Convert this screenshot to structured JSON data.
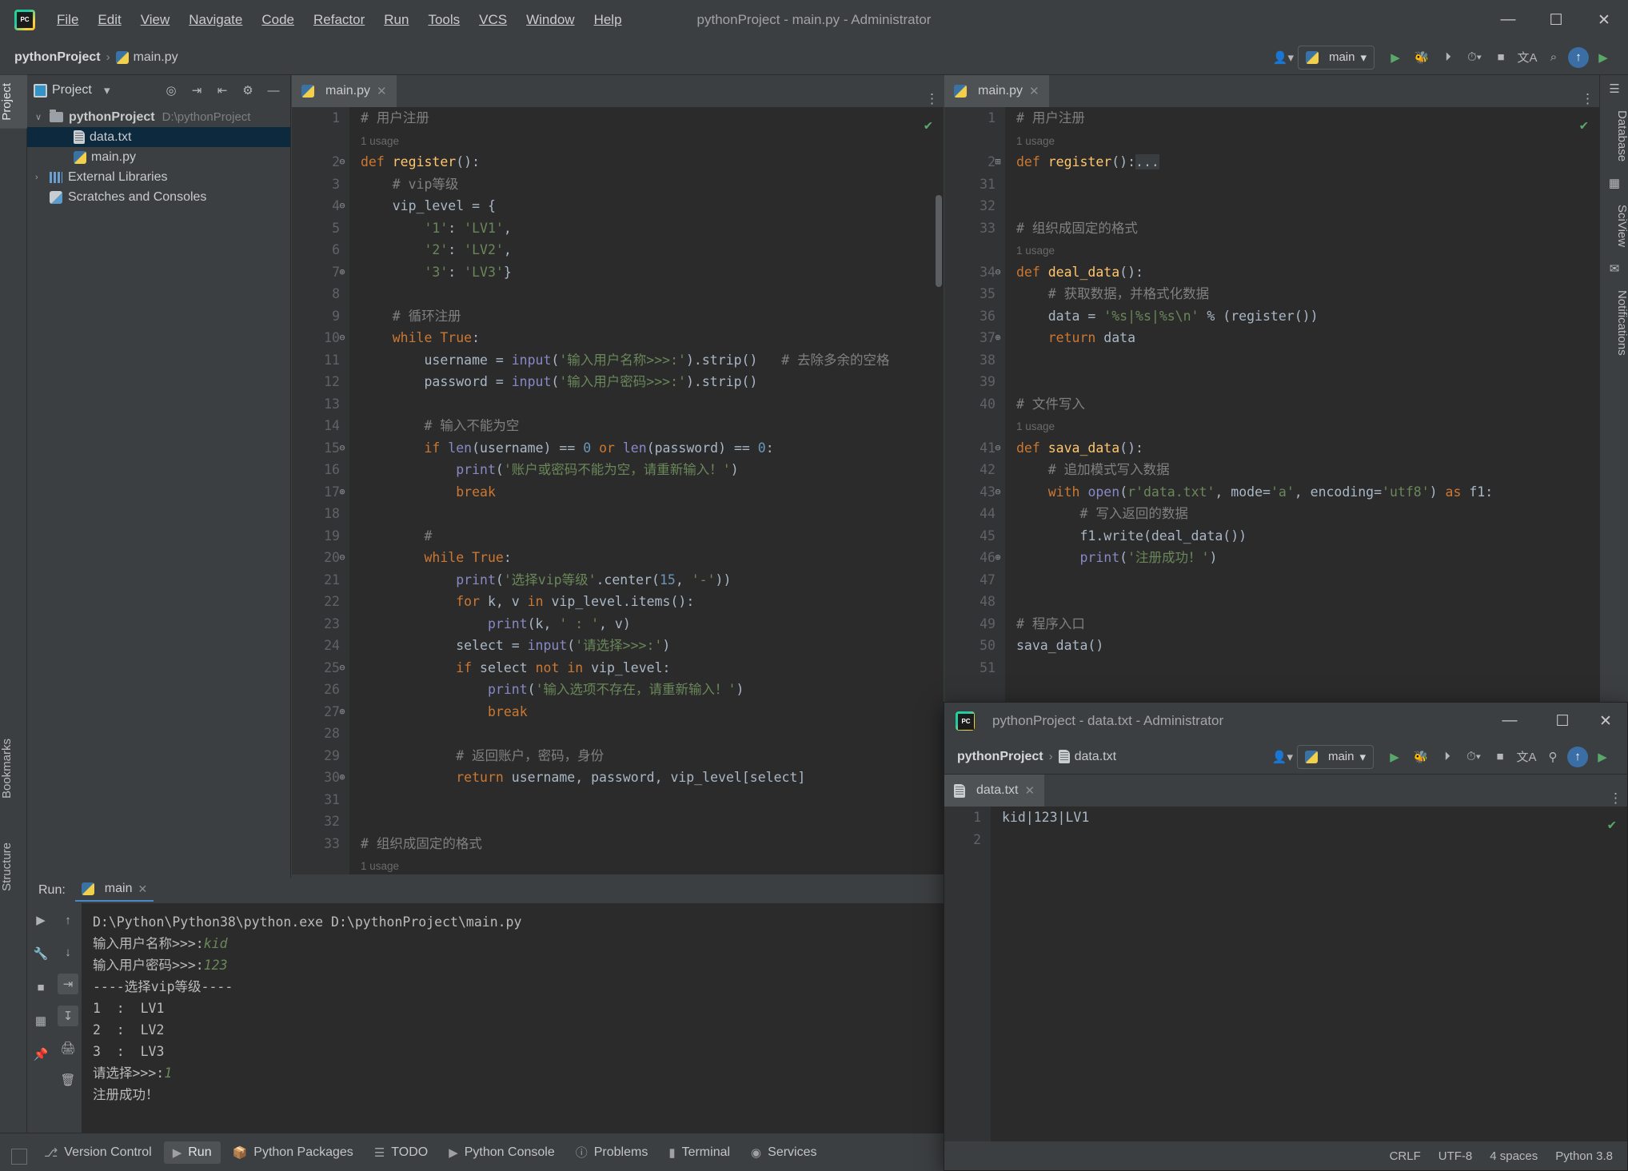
{
  "window": {
    "title": "pythonProject - main.py - Administrator",
    "controls": {
      "minimize": "—",
      "maximize": "☐",
      "close": "✕"
    }
  },
  "menubar": [
    {
      "label": "File"
    },
    {
      "label": "Edit"
    },
    {
      "label": "View"
    },
    {
      "label": "Navigate"
    },
    {
      "label": "Code"
    },
    {
      "label": "Refactor"
    },
    {
      "label": "Run"
    },
    {
      "label": "Tools"
    },
    {
      "label": "VCS"
    },
    {
      "label": "Window"
    },
    {
      "label": "Help"
    }
  ],
  "breadcrumb": {
    "project": "pythonProject",
    "separator": "›",
    "file": "main.py"
  },
  "toolbar": {
    "run_config": "main",
    "profile_icon": "user-icon",
    "run": "▶",
    "debug": "bug-icon",
    "coverage": "coverage-icon",
    "profile": "profiler-icon",
    "stop": "■",
    "translate": "translate-icon",
    "search": "⌕",
    "updates": "↑",
    "ide_run": "▶"
  },
  "sidebar": {
    "vertical_tabs": [
      "Project",
      "Bookmarks",
      "Structure"
    ],
    "panel_title": "Project",
    "header_icons": [
      "locate-icon",
      "expand-all-icon",
      "collapse-all-icon",
      "settings-icon",
      "hide-icon"
    ],
    "tree": [
      {
        "label": "pythonProject",
        "path": "D:\\pythonProject",
        "icon": "folder-icon",
        "arrow": "∨",
        "bold": true,
        "selected": false,
        "indent": 0
      },
      {
        "label": "data.txt",
        "path": "",
        "icon": "text-file-icon",
        "arrow": "",
        "bold": false,
        "selected": true,
        "indent": 1
      },
      {
        "label": "main.py",
        "path": "",
        "icon": "python-file-icon",
        "arrow": "",
        "bold": false,
        "selected": false,
        "indent": 1
      },
      {
        "label": "External Libraries",
        "path": "",
        "icon": "library-icon",
        "arrow": "›",
        "bold": false,
        "selected": false,
        "indent": 0
      },
      {
        "label": "Scratches and Consoles",
        "path": "",
        "icon": "scratch-icon",
        "arrow": "",
        "bold": false,
        "selected": false,
        "indent": 0
      }
    ]
  },
  "editors": {
    "left": {
      "tab_label": "main.py",
      "tab_close": "✕",
      "inspection_status": "✔",
      "lines": [
        {
          "no": "1",
          "fold": "",
          "html": "<span class='cmt'># 用户注册</span>"
        },
        {
          "no": "",
          "fold": "",
          "html": "<span class='usage'>1 usage</span>"
        },
        {
          "no": "2",
          "fold": "⊖",
          "html": "<span class='kw'>def</span> <span class='fn'>register</span>():"
        },
        {
          "no": "3",
          "fold": "",
          "html": "    <span class='cmt'># vip等级</span>"
        },
        {
          "no": "4",
          "fold": "⊖",
          "html": "    vip_level = {"
        },
        {
          "no": "5",
          "fold": "",
          "html": "        <span class='str'>'1'</span>: <span class='str'>'LV1'</span>,"
        },
        {
          "no": "6",
          "fold": "",
          "html": "        <span class='str'>'2'</span>: <span class='str'>'LV2'</span>,"
        },
        {
          "no": "7",
          "fold": "⊕",
          "html": "        <span class='str'>'3'</span>: <span class='str'>'LV3'</span>}"
        },
        {
          "no": "8",
          "fold": "",
          "html": ""
        },
        {
          "no": "9",
          "fold": "",
          "html": "    <span class='cmt'># 循环注册</span>"
        },
        {
          "no": "10",
          "fold": "⊖",
          "html": "    <span class='kw'>while True</span>:"
        },
        {
          "no": "11",
          "fold": "",
          "html": "        username = <span class='bi'>input</span>(<span class='str'>'输入用户名称&gt;&gt;&gt;:'</span>).strip()   <span class='cmt'># 去除多余的空格</span>"
        },
        {
          "no": "12",
          "fold": "",
          "html": "        password = <span class='bi'>input</span>(<span class='str'>'输入用户密码&gt;&gt;&gt;:'</span>).strip()"
        },
        {
          "no": "13",
          "fold": "",
          "html": ""
        },
        {
          "no": "14",
          "fold": "",
          "html": "        <span class='cmt'># 输入不能为空</span>"
        },
        {
          "no": "15",
          "fold": "⊖",
          "html": "        <span class='kw'>if</span> <span class='bi'>len</span>(username) == <span class='num'>0</span> <span class='kw'>or</span> <span class='bi'>len</span>(password) == <span class='num'>0</span>:"
        },
        {
          "no": "16",
          "fold": "",
          "html": "            <span class='bi'>print</span>(<span class='str'>'账户或密码不能为空，请重新输入！'</span>)"
        },
        {
          "no": "17",
          "fold": "⊕",
          "html": "            <span class='kw'>break</span>"
        },
        {
          "no": "18",
          "fold": "",
          "html": ""
        },
        {
          "no": "19",
          "fold": "",
          "html": "        <span class='cmt'>#</span>"
        },
        {
          "no": "20",
          "fold": "⊖",
          "html": "        <span class='kw'>while True</span>:"
        },
        {
          "no": "21",
          "fold": "",
          "html": "            <span class='bi'>print</span>(<span class='str'>'选择vip等级'</span>.center(<span class='num'>15</span>, <span class='str'>'-'</span>))"
        },
        {
          "no": "22",
          "fold": "",
          "html": "            <span class='kw'>for</span> k, v <span class='kw'>in</span> vip_level.items():"
        },
        {
          "no": "23",
          "fold": "",
          "html": "                <span class='bi'>print</span>(k, <span class='str'>' : '</span>, v)"
        },
        {
          "no": "24",
          "fold": "",
          "html": "            select = <span class='bi'>input</span>(<span class='str'>'请选择&gt;&gt;&gt;:'</span>)"
        },
        {
          "no": "25",
          "fold": "⊖",
          "html": "            <span class='kw'>if</span> select <span class='kw'>not in</span> vip_level:"
        },
        {
          "no": "26",
          "fold": "",
          "html": "                <span class='bi'>print</span>(<span class='str'>'输入选项不存在，请重新输入！'</span>)"
        },
        {
          "no": "27",
          "fold": "⊕",
          "html": "                <span class='kw'>break</span>"
        },
        {
          "no": "28",
          "fold": "",
          "html": ""
        },
        {
          "no": "29",
          "fold": "",
          "html": "            <span class='cmt'># 返回账户，密码，身份</span>"
        },
        {
          "no": "30",
          "fold": "⊕",
          "html": "            <span class='kw'>return</span> username, password, vip_level[select]"
        },
        {
          "no": "31",
          "fold": "",
          "html": ""
        },
        {
          "no": "32",
          "fold": "",
          "html": ""
        },
        {
          "no": "33",
          "fold": "",
          "html": "<span class='cmt'># 组织成固定的格式</span>"
        },
        {
          "no": "",
          "fold": "",
          "html": "<span class='usage'>1 usage</span>"
        }
      ]
    },
    "right": {
      "tab_label": "main.py",
      "tab_close": "✕",
      "inspection_status": "✔",
      "lines": [
        {
          "no": "1",
          "fold": "",
          "html": "<span class='cmt'># 用户注册</span>"
        },
        {
          "no": "",
          "fold": "",
          "html": "<span class='usage'>1 usage</span>"
        },
        {
          "no": "2",
          "fold": "⊞",
          "html": "<span class='kw'>def</span> <span class='fn'>register</span>():<span style='background:#3a3d3f;color:#a9b7c6'>...</span>"
        },
        {
          "no": "31",
          "fold": "",
          "html": ""
        },
        {
          "no": "32",
          "fold": "",
          "html": ""
        },
        {
          "no": "33",
          "fold": "",
          "html": "<span class='cmt'># 组织成固定的格式</span>"
        },
        {
          "no": "",
          "fold": "",
          "html": "<span class='usage'>1 usage</span>"
        },
        {
          "no": "34",
          "fold": "⊖",
          "html": "<span class='kw'>def</span> <span class='fn'>deal_data</span>():"
        },
        {
          "no": "35",
          "fold": "",
          "html": "    <span class='cmt'># 获取数据，并格式化数据</span>"
        },
        {
          "no": "36",
          "fold": "",
          "html": "    data = <span class='str'>'%s|%s|%s\\n'</span> % (register())"
        },
        {
          "no": "37",
          "fold": "⊕",
          "html": "    <span class='kw'>return</span> data"
        },
        {
          "no": "38",
          "fold": "",
          "html": ""
        },
        {
          "no": "39",
          "fold": "",
          "html": ""
        },
        {
          "no": "40",
          "fold": "",
          "html": "<span class='cmt'># 文件写入</span>"
        },
        {
          "no": "",
          "fold": "",
          "html": "<span class='usage'>1 usage</span>"
        },
        {
          "no": "41",
          "fold": "⊖",
          "html": "<span class='kw'>def</span> <span class='fn'>sava_data</span>():"
        },
        {
          "no": "42",
          "fold": "",
          "html": "    <span class='cmt'># 追加模式写入数据</span>"
        },
        {
          "no": "43",
          "fold": "⊖",
          "html": "    <span class='kw'>with</span> <span class='bi'>open</span>(<span class='str'>r'data.txt'</span>, mode=<span class='str'>'a'</span>, encoding=<span class='str'>'utf8'</span>) <span class='kw'>as</span> f1:"
        },
        {
          "no": "44",
          "fold": "",
          "html": "        <span class='cmt'># 写入返回的数据</span>"
        },
        {
          "no": "45",
          "fold": "",
          "html": "        f1.write(deal_data())"
        },
        {
          "no": "46",
          "fold": "⊕",
          "html": "        <span class='bi'>print</span>(<span class='str'>'注册成功！'</span>)"
        },
        {
          "no": "47",
          "fold": "",
          "html": ""
        },
        {
          "no": "48",
          "fold": "",
          "html": ""
        },
        {
          "no": "49",
          "fold": "",
          "html": "<span class='cmt'># 程序入口</span>"
        },
        {
          "no": "50",
          "fold": "",
          "html": "sava_data()"
        },
        {
          "no": "51",
          "fold": "",
          "html": ""
        }
      ]
    }
  },
  "run_panel": {
    "label": "Run:",
    "tab_label": "main",
    "tab_close": "✕",
    "tools_left": [
      "run-icon",
      "settings-wrench-icon",
      "stop-icon",
      "layout-icon",
      "pin-icon"
    ],
    "tools_right": [
      "up-arrow-icon",
      "down-arrow-icon",
      "soft-wrap-icon",
      "scroll-to-end-icon",
      "print-icon",
      "trash-icon"
    ],
    "output": [
      {
        "text": "D:\\Python\\Python38\\python.exe D:\\pythonProject\\main.py",
        "input": ""
      },
      {
        "text": "输入用户名称>>>:",
        "input": "kid"
      },
      {
        "text": "输入用户密码>>>:",
        "input": "123"
      },
      {
        "text": "----选择vip等级----",
        "input": ""
      },
      {
        "text": "1  :  LV1",
        "input": ""
      },
      {
        "text": "2  :  LV2",
        "input": ""
      },
      {
        "text": "3  :  LV3",
        "input": ""
      },
      {
        "text": "请选择>>>:",
        "input": "1"
      },
      {
        "text": "注册成功！",
        "input": ""
      }
    ]
  },
  "bottom_bar": [
    {
      "label": "Version Control",
      "icon": "branch-icon",
      "active": false
    },
    {
      "label": "Run",
      "icon": "run-icon",
      "active": true
    },
    {
      "label": "Python Packages",
      "icon": "package-icon",
      "active": false
    },
    {
      "label": "TODO",
      "icon": "todo-icon",
      "active": false
    },
    {
      "label": "Python Console",
      "icon": "console-icon",
      "active": false
    },
    {
      "label": "Problems",
      "icon": "problems-icon",
      "active": false
    },
    {
      "label": "Terminal",
      "icon": "terminal-icon",
      "active": false
    },
    {
      "label": "Services",
      "icon": "services-icon",
      "active": false
    }
  ],
  "right_strip": [
    {
      "label": "Database",
      "icon": "database-icon"
    },
    {
      "label": "SciView",
      "icon": "sciview-icon"
    },
    {
      "label": "Notifications",
      "icon": "notifications-icon"
    }
  ],
  "data_window": {
    "title": "pythonProject - data.txt - Administrator",
    "breadcrumb": {
      "project": "pythonProject",
      "separator": "›",
      "file": "data.txt"
    },
    "run_config": "main",
    "tab_label": "data.txt",
    "tab_close": "✕",
    "inspection_status": "✔",
    "lines": [
      {
        "no": "1",
        "text": "kid|123|LV1"
      },
      {
        "no": "2",
        "text": ""
      }
    ],
    "status": {
      "line_sep": "CRLF",
      "encoding": "UTF-8",
      "indent": "4 spaces",
      "interpreter": "Python 3.8"
    },
    "controls": {
      "minimize": "—",
      "maximize": "☐",
      "close": "✕"
    }
  },
  "colors": {
    "bg_chrome": "#3c3f41",
    "bg_editor": "#2b2b2b",
    "bg_gutter": "#313335",
    "accent_blue": "#4a88c7",
    "selection": "#0d293e",
    "keyword": "#cc7832",
    "string": "#6a8759",
    "number": "#6897bb",
    "function": "#ffc66d",
    "comment": "#808080",
    "builtin": "#8888c6",
    "ok_green": "#59a869"
  }
}
